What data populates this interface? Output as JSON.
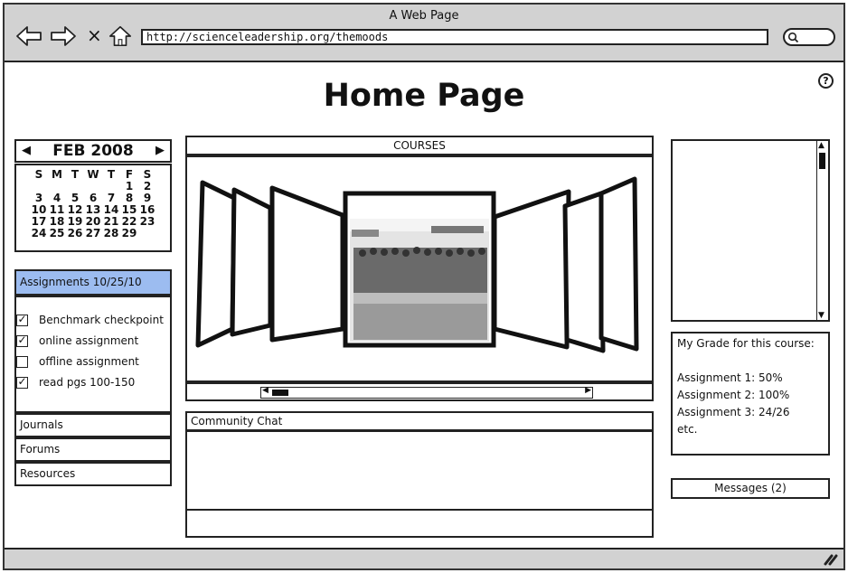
{
  "browser": {
    "window_title": "A Web Page",
    "url": "http://scienceleadership.org/themoods",
    "nav_icons": [
      "back-arrow-icon",
      "forward-arrow-icon",
      "stop-icon",
      "home-icon"
    ],
    "stop_glyph": "×",
    "search_icon": "search-icon"
  },
  "page": {
    "title": "Home Page",
    "help_glyph": "?"
  },
  "calendar": {
    "prev_glyph": "◀",
    "next_glyph": "▶",
    "month_label": "FEB 2008",
    "weekdays": [
      "S",
      "M",
      "T",
      "W",
      "T",
      "F",
      "S"
    ],
    "days": [
      "",
      "",
      "",
      "",
      "",
      "1",
      "2",
      "3",
      "4",
      "5",
      "6",
      "7",
      "8",
      "9",
      "10",
      "11",
      "12",
      "13",
      "14",
      "15",
      "16",
      "17",
      "18",
      "19",
      "20",
      "21",
      "22",
      "23",
      "24",
      "25",
      "26",
      "27",
      "28",
      "29",
      ""
    ]
  },
  "assignments": {
    "header": "Assignments 10/25/10",
    "items": [
      {
        "label": "Benchmark checkpoint",
        "checked": true
      },
      {
        "label": "online assignment",
        "checked": true
      },
      {
        "label": "offline assignment",
        "checked": false
      },
      {
        "label": "read pgs 100-150",
        "checked": true
      }
    ],
    "check_glyph": "✓"
  },
  "sidebar_links": [
    "Journals",
    "Forums",
    "Resources"
  ],
  "courses": {
    "header": "COURSES",
    "carousel_items": 7,
    "selected_index": 3,
    "scroll_position": 0.0
  },
  "chat": {
    "header": "Community Chat",
    "input_value": ""
  },
  "right_list": {
    "scroll_up_glyph": "▲",
    "scroll_down_glyph": "▼"
  },
  "grades": {
    "title": "My Grade for this course:",
    "lines": [
      "Assignment 1: 50%",
      "Assignment 2: 100%",
      "Assignment 3: 24/26",
      "etc."
    ]
  },
  "messages": {
    "label": "Messages (2)"
  },
  "hscroll": {
    "left_glyph": "◀",
    "right_glyph": "▶"
  }
}
